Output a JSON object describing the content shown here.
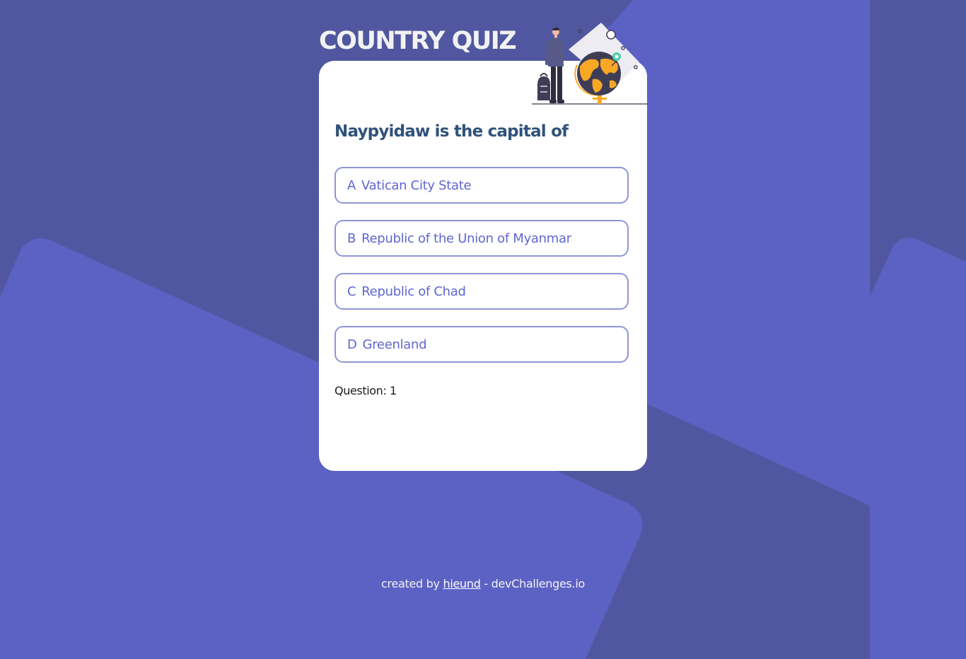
{
  "header": {
    "title": "COUNTRY QUIZ"
  },
  "quiz": {
    "question": "Naypyidaw is the capital of",
    "answers": [
      {
        "letter": "A",
        "text": "Vatican City State"
      },
      {
        "letter": "B",
        "text": "Republic of the Union of Myanmar"
      },
      {
        "letter": "C",
        "text": "Republic of Chad"
      },
      {
        "letter": "D",
        "text": "Greenland"
      }
    ],
    "counter": "Question: 1"
  },
  "footer": {
    "prefix": "created by",
    "author": "hieund",
    "suffix": "- devChallenges.io"
  },
  "colors": {
    "background": "#5057a0",
    "shape": "#5c62c4",
    "title": "#f2f2f2",
    "question": "#2f527b",
    "answer_border": "#8f95d6",
    "answer_text": "#6066d0",
    "card": "#ffffff"
  },
  "icons": {
    "illustration": "traveler-with-globe-illustration"
  }
}
